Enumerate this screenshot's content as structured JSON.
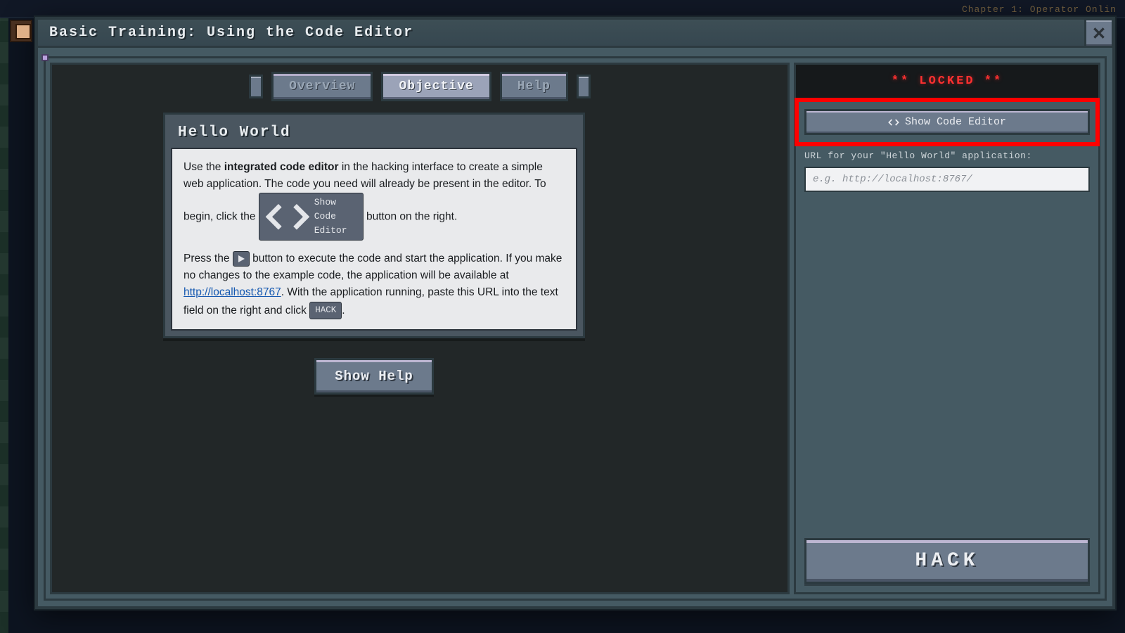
{
  "background": {
    "chapter_hint": "Chapter 1: Operator Onlin"
  },
  "modal": {
    "title": "Basic Training: Using the Code Editor"
  },
  "tabs": {
    "overview": "Overview",
    "objective": "Objective",
    "help": "Help",
    "active_index": 1
  },
  "content": {
    "heading": "Hello World",
    "p1_a": "Use the ",
    "p1_strong": "integrated code editor",
    "p1_b": " in the hacking interface to create a simple web application. The code you need will already be present in the editor. To begin, click the ",
    "inline_show_code": "Show Code Editor",
    "p1_c": " button on the right.",
    "p2_a": "Press the ",
    "p2_b": " button to execute the code and start the application. If you make no changes to the example code, the application will be available at ",
    "localhost_url": "http://localhost:8767",
    "p2_c": ". With the application running, paste this URL into the text field on the right and click ",
    "inline_hack": "HACK",
    "p2_d": "."
  },
  "buttons": {
    "show_help": "Show Help",
    "hack": "HACK"
  },
  "right": {
    "locked_label": "** LOCKED **",
    "show_code_editor": "Show Code Editor",
    "url_label": "URL for your \"Hello World\" application:",
    "url_placeholder": "e.g. http://localhost:8767/"
  }
}
